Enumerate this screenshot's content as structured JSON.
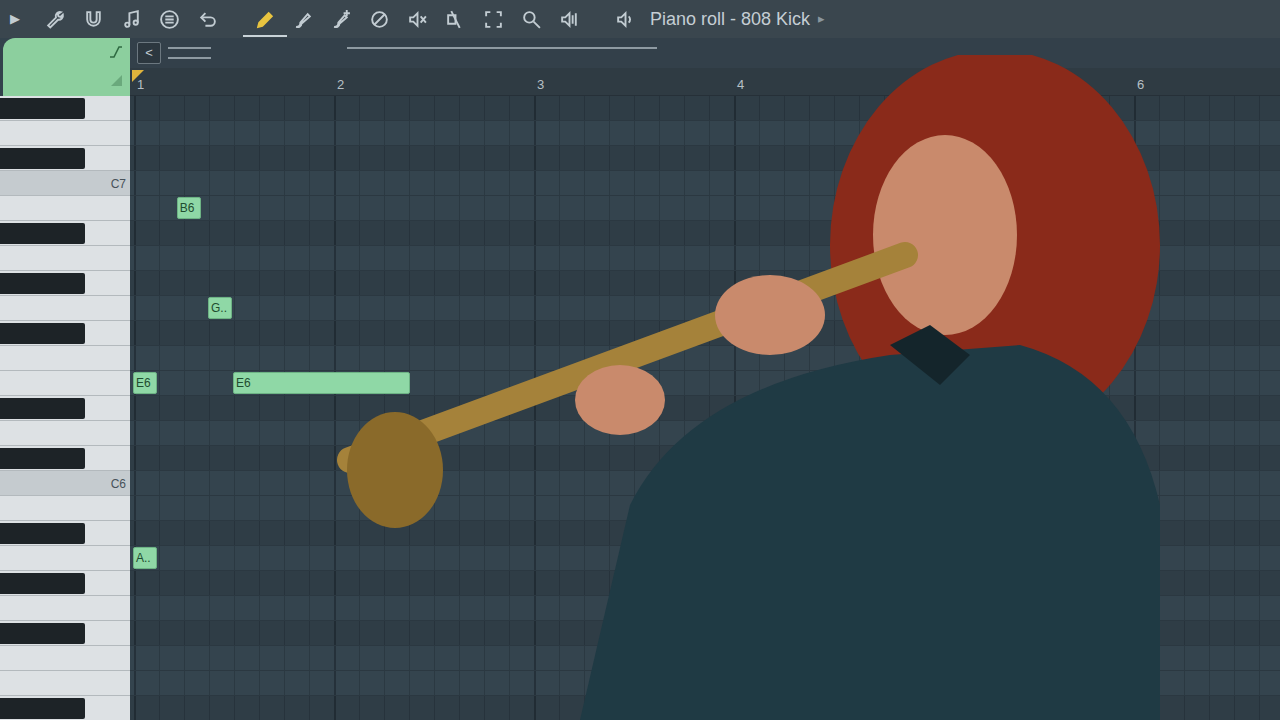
{
  "window": {
    "title": "Piano roll - 808 Kick",
    "title_arrow": "▸"
  },
  "toolbar": {
    "menu_arrow": "▶",
    "tools": [
      {
        "selected": false
      },
      {
        "selected": false
      },
      {
        "selected": false
      },
      {
        "selected": false
      },
      {
        "selected": false
      },
      {
        "selected": true
      },
      {
        "selected": false
      },
      {
        "selected": false
      },
      {
        "selected": false
      },
      {
        "selected": false
      },
      {
        "selected": false
      },
      {
        "selected": false
      },
      {
        "selected": false
      },
      {
        "selected": false
      },
      {
        "selected": false
      }
    ]
  },
  "panel": {
    "collapse_button": "<"
  },
  "timeline": {
    "bars": [
      "1",
      "2",
      "3",
      "4",
      "6"
    ]
  },
  "keyboard": {
    "labels": [
      {
        "label": "C7",
        "pitch": 12
      },
      {
        "label": "C6",
        "pitch": 0
      }
    ]
  },
  "notes": [
    {
      "label": "E6",
      "pitch": 4,
      "start": 0,
      "length": 2
    },
    {
      "label": "A..",
      "pitch": -3,
      "start": 0,
      "length": 2
    },
    {
      "label": "B6",
      "pitch": 11,
      "start": 3.5,
      "length": 2
    },
    {
      "label": "G..",
      "pitch": 7,
      "start": 6,
      "length": 2
    },
    {
      "label": "E6",
      "pitch": 4,
      "start": 8,
      "length": 14.25
    }
  ]
}
